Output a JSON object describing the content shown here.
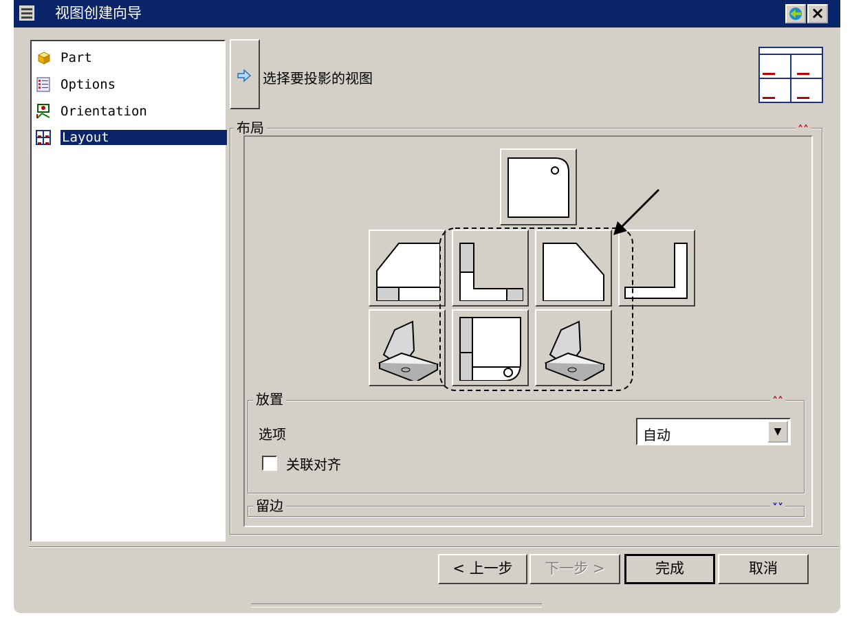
{
  "window": {
    "title": "视图创建向导"
  },
  "tree": {
    "items": [
      {
        "label": "Part",
        "icon": "cube-icon"
      },
      {
        "label": "Options",
        "icon": "options-list-icon"
      },
      {
        "label": "Orientation",
        "icon": "orientation-icon"
      },
      {
        "label": "Layout",
        "icon": "layout-grid-icon",
        "selected": true
      }
    ]
  },
  "step": {
    "instruction": "选择要投影的视图"
  },
  "layout_group": {
    "label": "布局"
  },
  "placement_group": {
    "label": "放置",
    "option_label": "选项",
    "option_value": "自动",
    "associative_align_label": "关联对齐",
    "associative_align_checked": false
  },
  "margin_group": {
    "label": "留边"
  },
  "buttons": {
    "back": "< 上一步",
    "next": "下一步 >",
    "finish": "完成",
    "cancel": "取消"
  },
  "colors": {
    "title_bar": "#0a246a",
    "dialog_bg": "#d4d0c8",
    "selection": "#0a246a"
  }
}
